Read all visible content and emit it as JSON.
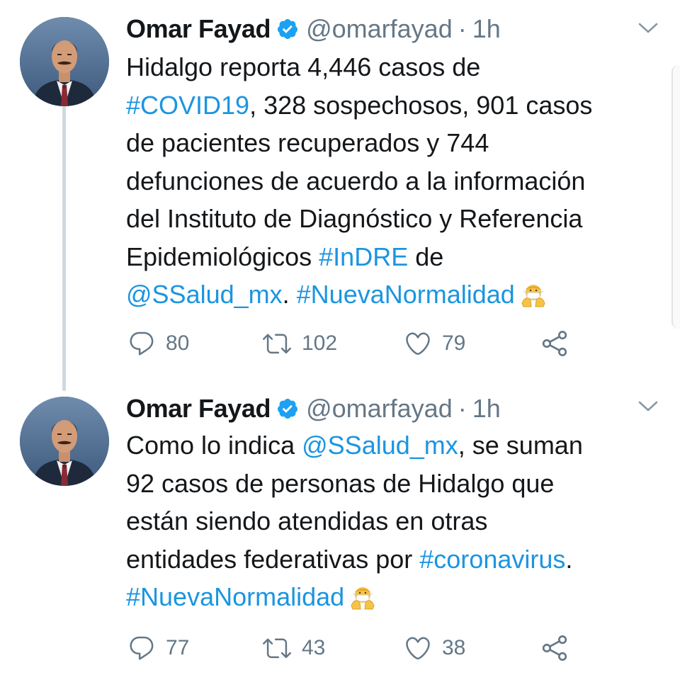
{
  "colors": {
    "link": "#1b95e0",
    "text": "#14171a",
    "muted": "#657786",
    "verified": "#1da1f2",
    "thread_line": "#cfd9de"
  },
  "icons": {
    "verified": "verified-badge-icon",
    "caret": "chevron-down-icon",
    "reply": "reply-icon",
    "retweet": "retweet-icon",
    "like": "heart-icon",
    "share": "share-icon",
    "emoji": "person-with-folded-hands-mask-emoji"
  },
  "tweets": [
    {
      "author": {
        "name": "Omar Fayad",
        "handle": "@omarfayad"
      },
      "separator": "·",
      "time": "1h",
      "lines": [
        [
          {
            "text": "Hidalgo reporta 4,446 casos de"
          }
        ],
        [
          {
            "text": "#COVID19",
            "link": true
          },
          {
            "text": ", 328 sospechosos, 901 casos"
          }
        ],
        [
          {
            "text": "de pacientes recuperados y 744"
          }
        ],
        [
          {
            "text": "defunciones de acuerdo a la información"
          }
        ],
        [
          {
            "text": "del Instituto de Diagnóstico y Referencia"
          }
        ],
        [
          {
            "text": "Epidemiológicos "
          },
          {
            "text": "#InDRE",
            "link": true
          },
          {
            "text": " de"
          }
        ],
        [
          {
            "text": "@SSalud_mx",
            "link": true
          },
          {
            "text": ". "
          },
          {
            "text": "#NuevaNormalidad",
            "link": true
          },
          {
            "emoji": true
          }
        ]
      ],
      "stats": {
        "replies": "80",
        "retweets": "102",
        "likes": "79"
      }
    },
    {
      "author": {
        "name": "Omar Fayad",
        "handle": "@omarfayad"
      },
      "separator": "·",
      "time": "1h",
      "lines": [
        [
          {
            "text": "Como lo indica "
          },
          {
            "text": "@SSalud_mx",
            "link": true
          },
          {
            "text": ", se suman"
          }
        ],
        [
          {
            "text": "92 casos de personas de Hidalgo que"
          }
        ],
        [
          {
            "text": "están siendo atendidas en otras"
          }
        ],
        [
          {
            "text": "entidades federativas por "
          },
          {
            "text": "#coronavirus",
            "link": true
          },
          {
            "text": "."
          }
        ],
        [
          {
            "text": "#NuevaNormalidad",
            "link": true
          },
          {
            "emoji": true
          }
        ]
      ],
      "stats": {
        "replies": "77",
        "retweets": "43",
        "likes": "38"
      }
    }
  ]
}
